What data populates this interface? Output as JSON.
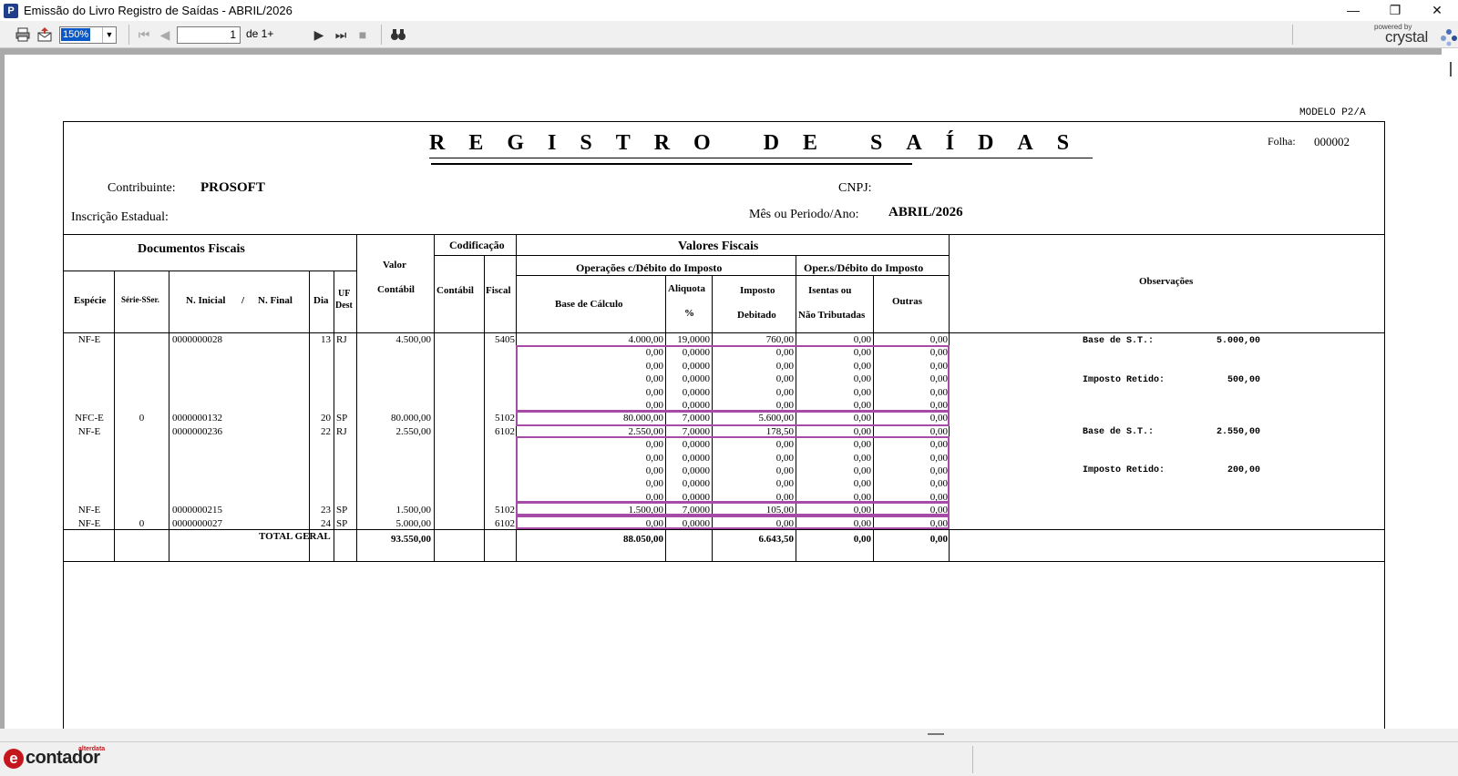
{
  "window": {
    "title": "Emissão do Livro Registro de Saídas - ABRIL/2026",
    "app_icon": "P",
    "minimize": "—",
    "maximize": "❐",
    "close": "✕"
  },
  "toolbar": {
    "zoom": "150%",
    "page_current": "1",
    "page_of": "de 1+",
    "crystal_small": "powered by",
    "crystal_brand": "crystal"
  },
  "report": {
    "modelo": "MODELO P2/A",
    "title": "REGISTRO DE SAÍDAS",
    "folha_label": "Folha:",
    "folha_value": "000002",
    "contribuinte_label": "Contribuinte:",
    "contribuinte_value": "PROSOFT",
    "cnpj_label": "CNPJ:",
    "inscricao_label": "Inscrição Estadual:",
    "periodo_label": "Mês ou Periodo/Ano:",
    "periodo_value": "ABRIL/2026",
    "headers": {
      "documentos": "Documentos Fiscais",
      "valor": "Valor",
      "contabil_col": "Contábil",
      "codificacao": "Codificação",
      "cod_contabil": "Contábil",
      "cod_fiscal": "Fiscal",
      "valores_fiscais": "Valores Fiscais",
      "op_com_debito": "Operações c/Débito do Imposto",
      "op_sem_debito": "Oper.s/Débito do Imposto",
      "especie": "Espécie",
      "serie": "Série-SSer.",
      "n_inicial": "N. Inicial",
      "slash": "/",
      "n_final": "N. Final",
      "dia": "Dia",
      "uf": "UF",
      "dest": "Dest",
      "base_calculo": "Base de Cálculo",
      "aliquota": "Aliquota",
      "percent": "%",
      "imposto": "Imposto",
      "debitado": "Debitado",
      "isentas": "Isentas ou",
      "nao_tributadas": "Não Tributadas",
      "outras": "Outras",
      "observacoes": "Observações"
    },
    "rows": [
      {
        "especie": "NF-E",
        "serie": "",
        "numero": "0000000028",
        "dia": "13",
        "uf": "RJ",
        "valor": "4.500,00",
        "fiscal": "5405",
        "base": "4.000,00",
        "aliq": "19,0000",
        "imposto": "760,00",
        "isentas": "0,00",
        "outras": "0,00"
      },
      {
        "especie": "",
        "serie": "",
        "numero": "",
        "dia": "",
        "uf": "",
        "valor": "",
        "fiscal": "",
        "base": "0,00",
        "aliq": "0,0000",
        "imposto": "0,00",
        "isentas": "0,00",
        "outras": "0,00"
      },
      {
        "especie": "",
        "serie": "",
        "numero": "",
        "dia": "",
        "uf": "",
        "valor": "",
        "fiscal": "",
        "base": "0,00",
        "aliq": "0,0000",
        "imposto": "0,00",
        "isentas": "0,00",
        "outras": "0,00"
      },
      {
        "especie": "",
        "serie": "",
        "numero": "",
        "dia": "",
        "uf": "",
        "valor": "",
        "fiscal": "",
        "base": "0,00",
        "aliq": "0,0000",
        "imposto": "0,00",
        "isentas": "0,00",
        "outras": "0,00"
      },
      {
        "especie": "",
        "serie": "",
        "numero": "",
        "dia": "",
        "uf": "",
        "valor": "",
        "fiscal": "",
        "base": "0,00",
        "aliq": "0,0000",
        "imposto": "0,00",
        "isentas": "0,00",
        "outras": "0,00"
      },
      {
        "especie": "",
        "serie": "",
        "numero": "",
        "dia": "",
        "uf": "",
        "valor": "",
        "fiscal": "",
        "base": "0,00",
        "aliq": "0,0000",
        "imposto": "0,00",
        "isentas": "0,00",
        "outras": "0,00"
      },
      {
        "especie": "NFC-E",
        "serie": "0",
        "numero": "0000000132",
        "dia": "20",
        "uf": "SP",
        "valor": "80.000,00",
        "fiscal": "5102",
        "base": "80.000,00",
        "aliq": "7,0000",
        "imposto": "5.600,00",
        "isentas": "0,00",
        "outras": "0,00"
      },
      {
        "especie": "NF-E",
        "serie": "",
        "numero": "0000000236",
        "dia": "22",
        "uf": "RJ",
        "valor": "2.550,00",
        "fiscal": "6102",
        "base": "2.550,00",
        "aliq": "7,0000",
        "imposto": "178,50",
        "isentas": "0,00",
        "outras": "0,00"
      },
      {
        "especie": "",
        "serie": "",
        "numero": "",
        "dia": "",
        "uf": "",
        "valor": "",
        "fiscal": "",
        "base": "0,00",
        "aliq": "0,0000",
        "imposto": "0,00",
        "isentas": "0,00",
        "outras": "0,00"
      },
      {
        "especie": "",
        "serie": "",
        "numero": "",
        "dia": "",
        "uf": "",
        "valor": "",
        "fiscal": "",
        "base": "0,00",
        "aliq": "0,0000",
        "imposto": "0,00",
        "isentas": "0,00",
        "outras": "0,00"
      },
      {
        "especie": "",
        "serie": "",
        "numero": "",
        "dia": "",
        "uf": "",
        "valor": "",
        "fiscal": "",
        "base": "0,00",
        "aliq": "0,0000",
        "imposto": "0,00",
        "isentas": "0,00",
        "outras": "0,00"
      },
      {
        "especie": "",
        "serie": "",
        "numero": "",
        "dia": "",
        "uf": "",
        "valor": "",
        "fiscal": "",
        "base": "0,00",
        "aliq": "0,0000",
        "imposto": "0,00",
        "isentas": "0,00",
        "outras": "0,00"
      },
      {
        "especie": "",
        "serie": "",
        "numero": "",
        "dia": "",
        "uf": "",
        "valor": "",
        "fiscal": "",
        "base": "0,00",
        "aliq": "0,0000",
        "imposto": "0,00",
        "isentas": "0,00",
        "outras": "0,00"
      },
      {
        "especie": "NF-E",
        "serie": "",
        "numero": "0000000215",
        "dia": "23",
        "uf": "SP",
        "valor": "1.500,00",
        "fiscal": "5102",
        "base": "1.500,00",
        "aliq": "7,0000",
        "imposto": "105,00",
        "isentas": "0,00",
        "outras": "0,00"
      },
      {
        "especie": "NF-E",
        "serie": "0",
        "numero": "0000000027",
        "dia": "24",
        "uf": "SP",
        "valor": "5.000,00",
        "fiscal": "6102",
        "base": "0,00",
        "aliq": "0,0000",
        "imposto": "0,00",
        "isentas": "0,00",
        "outras": "0,00"
      }
    ],
    "observations": [
      {
        "label": "Base de S.T.:",
        "value": "5.000,00"
      },
      {
        "label": "Imposto Retido:",
        "value": "500,00"
      },
      {
        "label": "Base de S.T.:",
        "value": "2.550,00"
      },
      {
        "label": "Imposto Retido:",
        "value": "200,00"
      }
    ],
    "totals": {
      "label": "TOTAL GERAL",
      "valor": "93.550,00",
      "base": "88.050,00",
      "imposto": "6.643,50",
      "isentas": "0,00",
      "outras": "0,00"
    }
  },
  "status": {
    "brand_small": "alterdata",
    "brand": "contador",
    "brand_mark": "e"
  }
}
